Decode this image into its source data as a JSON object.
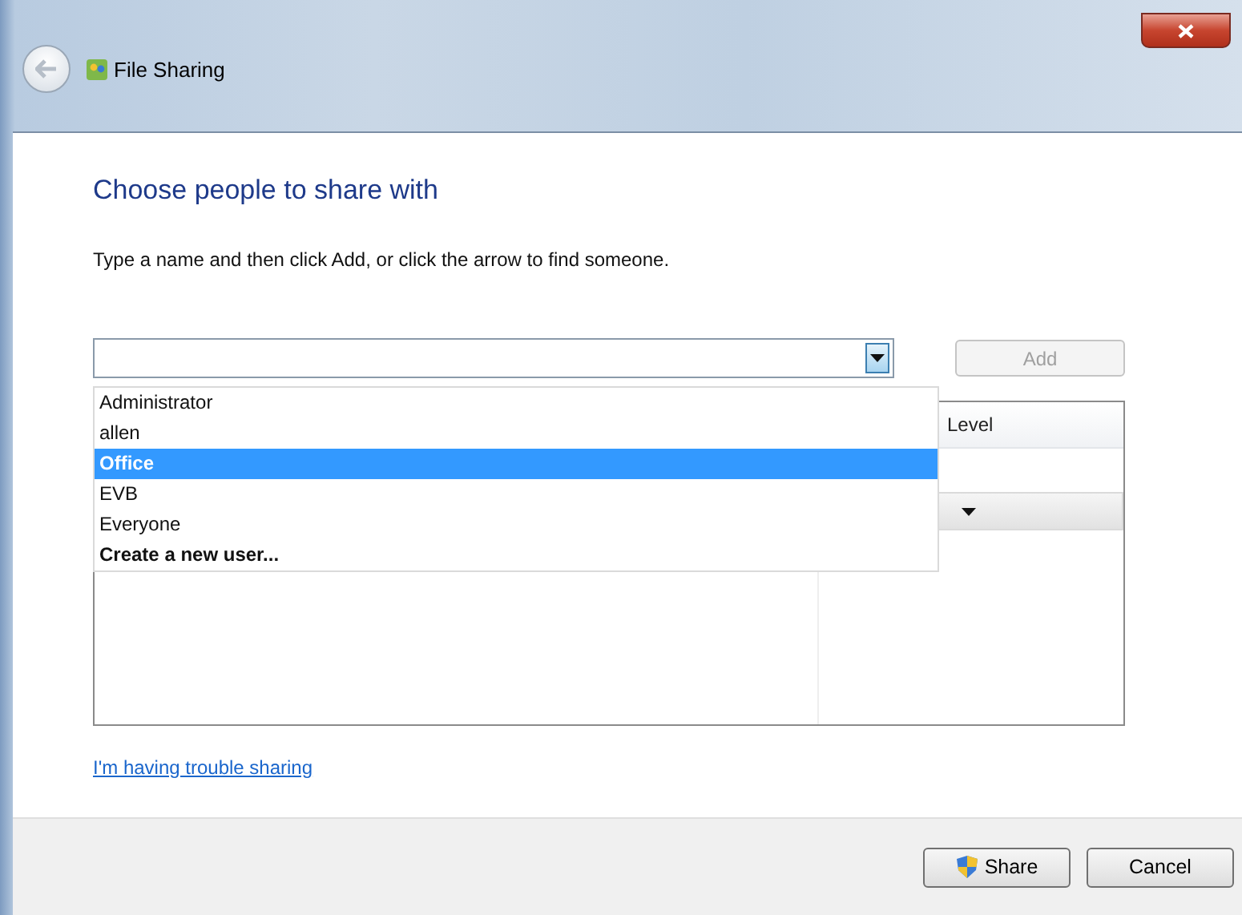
{
  "window": {
    "title": "File Sharing"
  },
  "heading": "Choose people to share with",
  "instruction": "Type a name and then click Add, or click the arrow to find someone.",
  "name_field": {
    "expanded": true
  },
  "add_button": {
    "label": "Add",
    "disabled": true
  },
  "table": {
    "columns": [
      {
        "label": "Level"
      }
    ]
  },
  "suggestions": [
    {
      "label": "Administrator",
      "selected": false,
      "kind": "user"
    },
    {
      "label": "allen",
      "selected": false,
      "kind": "user"
    },
    {
      "label": "Office",
      "selected": true,
      "kind": "user"
    },
    {
      "label": "EVB",
      "selected": false,
      "kind": "user"
    },
    {
      "label": "Everyone",
      "selected": false,
      "kind": "user"
    },
    {
      "label": "Create a new user...",
      "selected": false,
      "kind": "action"
    }
  ],
  "help_link": "I'm having trouble sharing",
  "buttons": [
    {
      "label": "Share",
      "kind": "shield"
    },
    {
      "label": "Cancel",
      "kind": "plain"
    }
  ]
}
